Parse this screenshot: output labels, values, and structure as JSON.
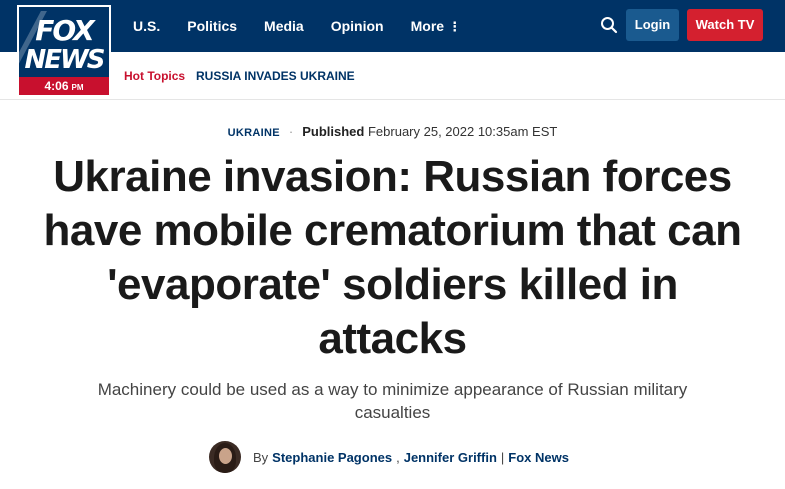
{
  "logo": {
    "line1": "FOX",
    "line2": "NEWS",
    "time": "4:06",
    "ampm": "PM"
  },
  "nav": {
    "items": [
      "U.S.",
      "Politics",
      "Media",
      "Opinion",
      "More"
    ],
    "login": "Login",
    "watch_tv": "Watch TV"
  },
  "subnav": {
    "hot_topics": "Hot Topics",
    "russia": "RUSSIA INVADES UKRAINE"
  },
  "article": {
    "category": "UKRAINE",
    "published_label": "Published",
    "published_date": "February 25, 2022 10:35am EST",
    "headline": "Ukraine invasion: Russian forces have mobile crematorium that can 'evaporate' soldiers killed in attacks",
    "subhead": "Machinery could be used as a way to minimize appearance of Russian military casualties",
    "byline": {
      "by": "By",
      "author1": "Stephanie Pagones",
      "comma": ",",
      "author2": "Jennifer Griffin",
      "pipe": "|",
      "outlet": "Fox News"
    }
  },
  "colors": {
    "navy": "#003366",
    "red": "#d4202f",
    "login_blue": "#1a5a8f"
  }
}
